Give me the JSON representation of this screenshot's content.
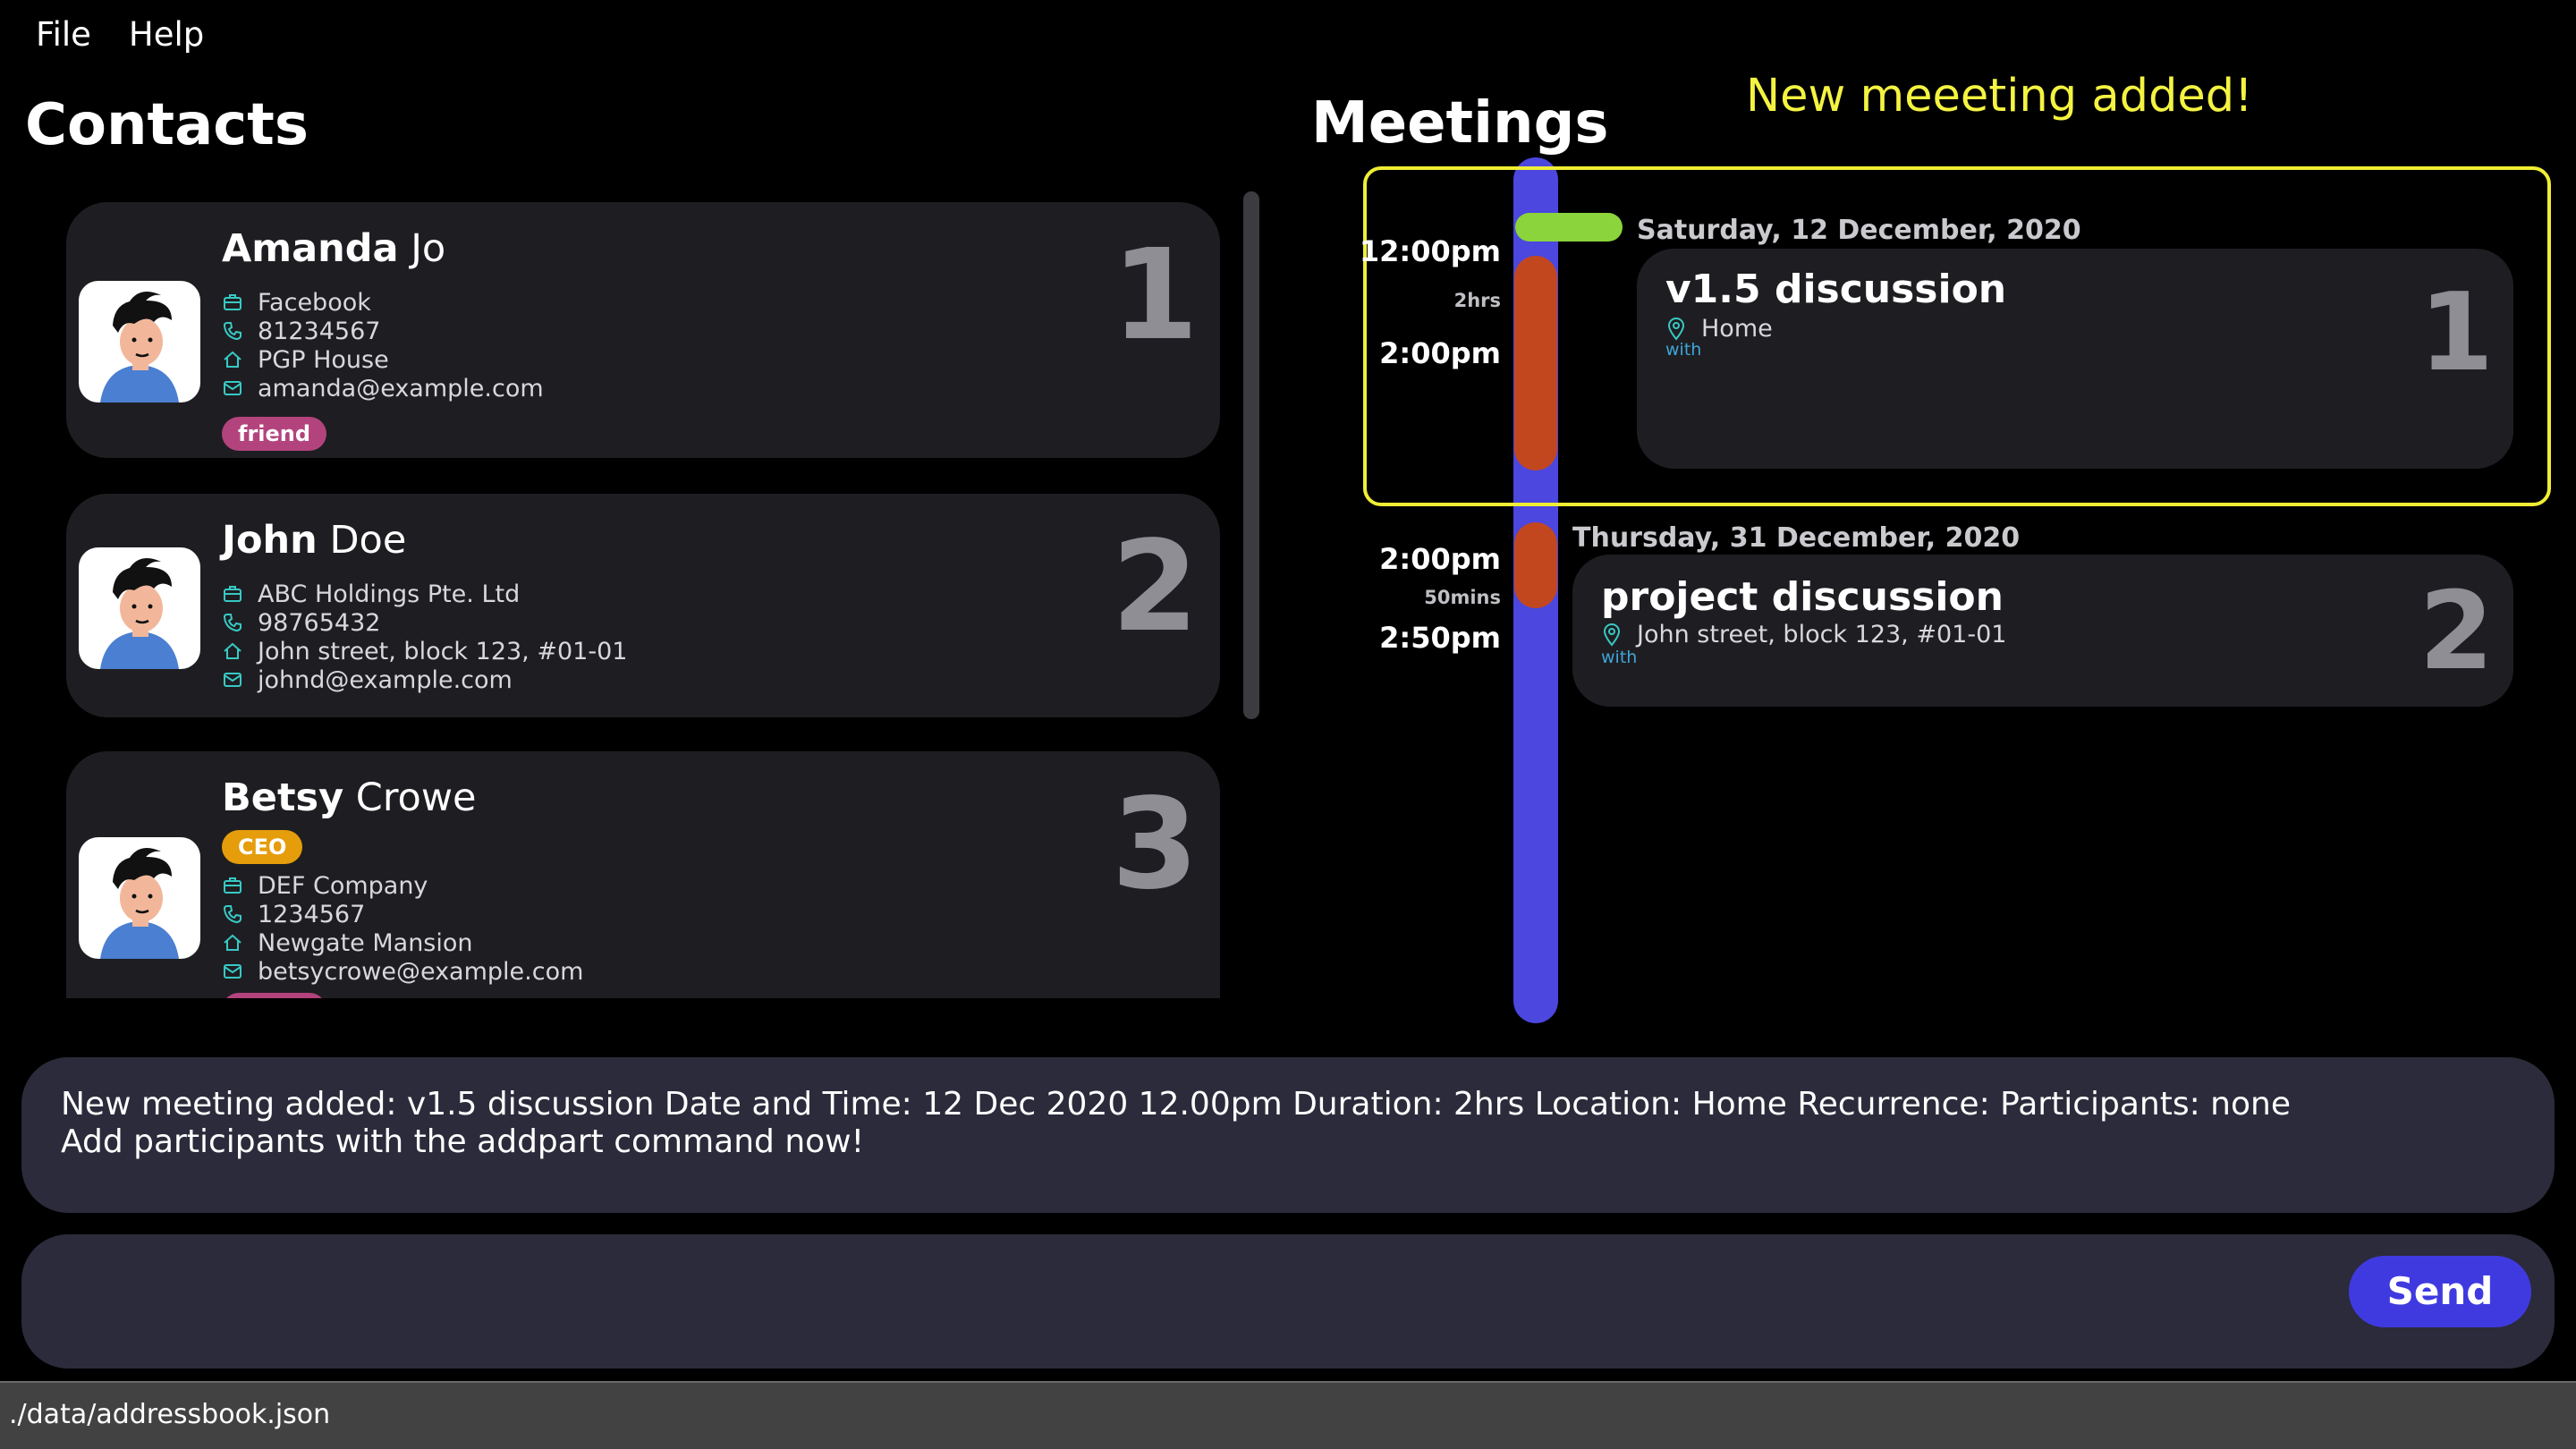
{
  "menu": {
    "file": "File",
    "help": "Help"
  },
  "contacts": {
    "title": "Contacts",
    "items": [
      {
        "first": "Amanda",
        "last": "Jo",
        "company": "Facebook",
        "phone": "81234567",
        "address": "PGP House",
        "email": "amanda@example.com",
        "tags": [
          "friend"
        ],
        "index": "1"
      },
      {
        "first": "John",
        "last": "Doe",
        "company": "ABC Holdings Pte. Ltd",
        "phone": "98765432",
        "address": "John street, block 123, #01-01",
        "email": "johnd@example.com",
        "tags": [],
        "index": "2"
      },
      {
        "first": "Betsy",
        "last": "Crowe",
        "company": "DEF Company",
        "phone": "1234567",
        "address": "Newgate Mansion",
        "email": "betsycrowe@example.com",
        "tags": [
          "CEO",
          "friend"
        ],
        "index": "3"
      }
    ]
  },
  "meetings": {
    "title": "Meetings",
    "announcement": "New meeeting added!",
    "items": [
      {
        "date": "Saturday, 12 December, 2020",
        "start": "12:00pm",
        "duration": "2hrs",
        "end": "2:00pm",
        "title": "v1.5 discussion",
        "location": "Home",
        "with": "with",
        "index": "1"
      },
      {
        "date": "Thursday, 31 December, 2020",
        "start": "2:00pm",
        "duration": "50mins",
        "end": "2:50pm",
        "title": "project discussion",
        "location": "John street, block 123, #01-01",
        "with": "with",
        "index": "2"
      }
    ]
  },
  "result": {
    "line1": "New meeting added: v1.5 discussion Date and Time: 12 Dec 2020 12.00pm Duration: 2hrs Location: Home Recurrence:  Participants: none",
    "line2": "Add participants with the addpart command now!"
  },
  "command": {
    "value": "",
    "send_label": "Send"
  },
  "status": {
    "path": "./data/addressbook.json"
  },
  "colors": {
    "accent": "#4b47df",
    "announcement": "#f4f341",
    "tag_friend": "#b3437d",
    "tag_ceo": "#e59d0b",
    "meeting_start": "#8bd43c",
    "meeting_duration": "#c2471f",
    "icon": "#38c9c4"
  },
  "icons": {
    "company": "briefcase-icon",
    "phone": "phone-icon",
    "address": "home-icon",
    "email": "mail-icon",
    "location": "location-pin-icon"
  }
}
